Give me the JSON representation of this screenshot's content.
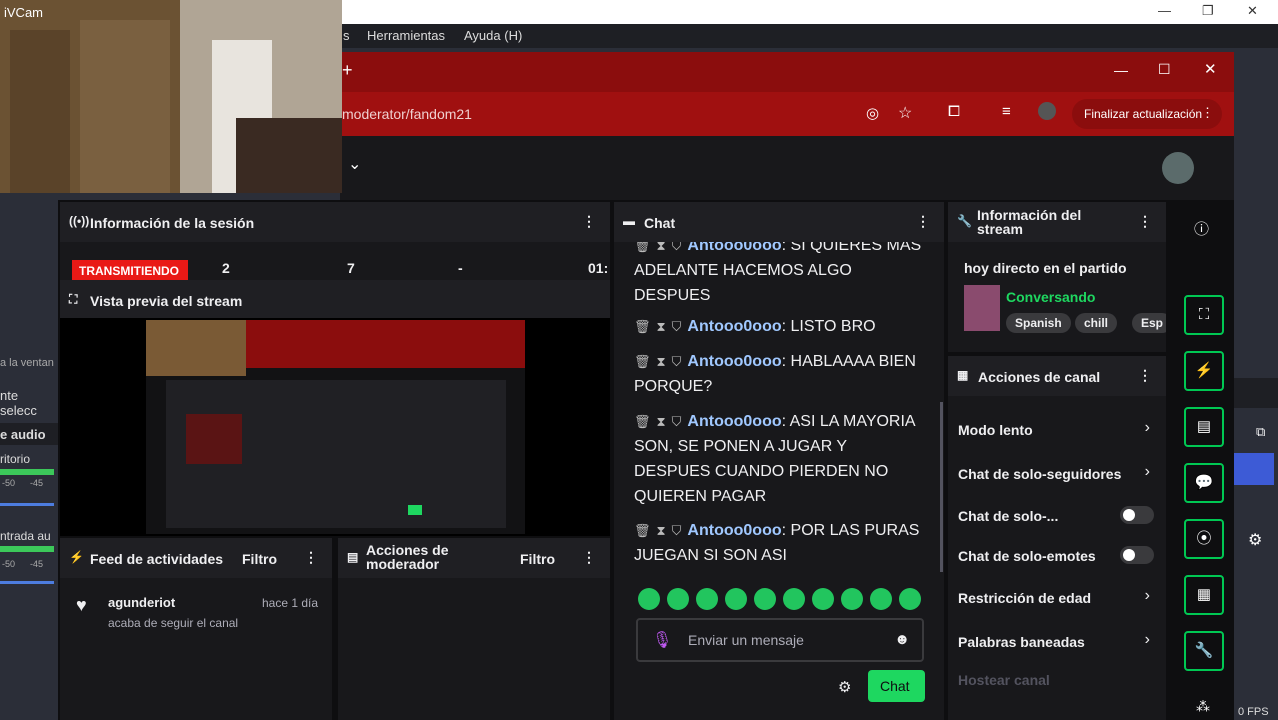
{
  "webcam": {
    "app_title": "iVCam"
  },
  "obs": {
    "menu": [
      "s",
      "Herramientas",
      "Ayuda (H)"
    ],
    "left_labels": [
      "a la ventan",
      "nte selecc",
      "e audio",
      "ritorio",
      "-50",
      "-45",
      "ntrada au",
      "-50",
      "-45"
    ],
    "fps": "0 FPS"
  },
  "browser": {
    "new_tab": "+",
    "url": "moderator/fandom21",
    "update_button": "Finalizar actualización"
  },
  "session": {
    "title": "Información de la sesión",
    "live_badge": "TRANSMITIENDO",
    "stats": [
      "2",
      "7",
      "-",
      "01:"
    ]
  },
  "preview": {
    "title": "Vista previa del stream"
  },
  "feed": {
    "title": "Feed de actividades",
    "filter": "Filtro",
    "event": {
      "user": "agunderiot",
      "time": "hace 1 día",
      "text": "acaba de seguir el canal"
    }
  },
  "modactions": {
    "title_line1": "Acciones de",
    "title_line2": "moderador",
    "filter": "Filtro"
  },
  "chat": {
    "title": "Chat",
    "messages": [
      {
        "user": "Antooo0ooo",
        "text": ": SI QUIERES MAS ADELANTE HACEMOS ALGO DESPUES"
      },
      {
        "user": "Antooo0ooo",
        "text": ": LISTO BRO"
      },
      {
        "user": "Antooo0ooo",
        "text": ": HABLAAAA BIEN PORQUE?"
      },
      {
        "user": "Antooo0ooo",
        "text": ": ASI LA MAYORIA SON, SE PONEN A JUGAR Y DESPUES CUANDO PIERDEN NO QUIEREN PAGAR"
      },
      {
        "user": "Antooo0ooo",
        "text": ": POR LAS PURAS JUEGAN SI SON ASI"
      }
    ],
    "placeholder": "Enviar un mensaje",
    "send_label": "Chat"
  },
  "streaminfo": {
    "title_line1": "Información del",
    "title_line2": "stream",
    "stream_title": "hoy directo en el partido",
    "category": "Conversando",
    "tags": [
      "Spanish",
      "chill",
      "Esp"
    ]
  },
  "channelactions": {
    "title": "Acciones de canal",
    "items": [
      {
        "label": "Modo lento",
        "control": "chevron"
      },
      {
        "label": "Chat de solo-seguidores",
        "control": "chevron"
      },
      {
        "label": "Chat de solo-...",
        "control": "toggle"
      },
      {
        "label": "Chat de solo-emotes",
        "control": "toggle"
      },
      {
        "label": "Restricción de edad",
        "control": "chevron"
      },
      {
        "label": "Palabras baneadas",
        "control": "chevron"
      },
      {
        "label": "Hostear canal",
        "control": "none"
      }
    ]
  },
  "colors": {
    "live": "#e91916",
    "accent": "#00c853",
    "chrome": "#a01010",
    "send": "#1ed760"
  }
}
